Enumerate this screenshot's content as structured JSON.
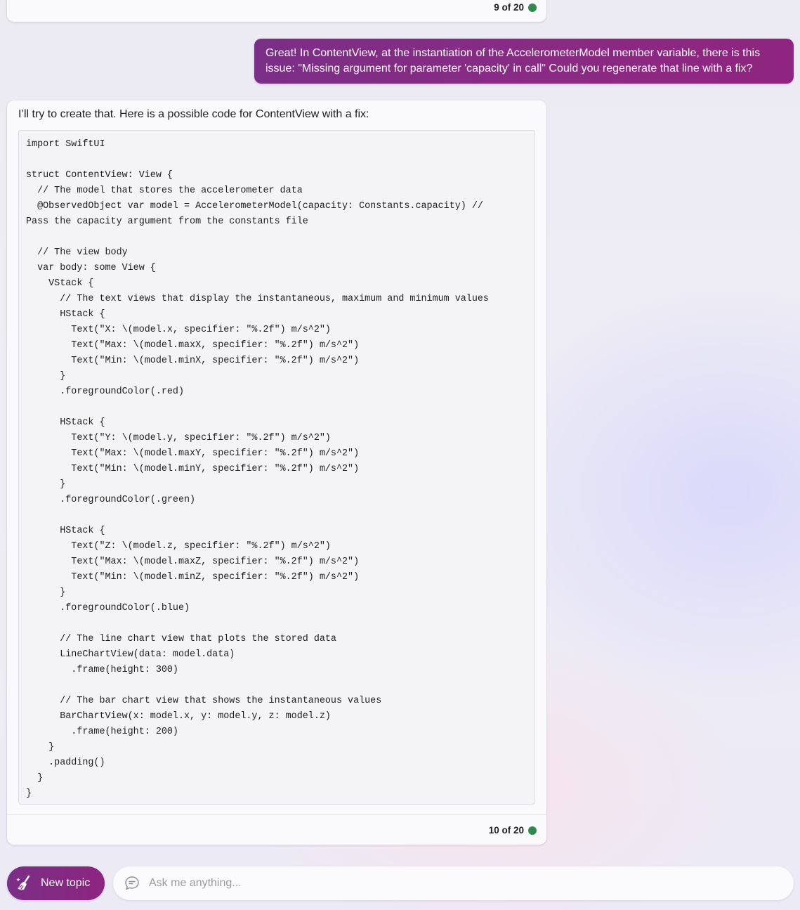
{
  "previous_message": {
    "counter": "9 of 20",
    "status_color": "#2f8a4c"
  },
  "user_message": {
    "text": "Great! In ContentView, at the instantiation of the AccelerometerModel member variable, there is this issue: \"Missing argument for parameter 'capacity' in call\" Could you regenerate that line with a fix?"
  },
  "bot_message": {
    "intro": "I’ll try to create that. Here is a possible code for ContentView with a fix:",
    "code": "import SwiftUI\n\nstruct ContentView: View {\n  // The model that stores the accelerometer data\n  @ObservedObject var model = AccelerometerModel(capacity: Constants.capacity) //\nPass the capacity argument from the constants file\n\n  // The view body\n  var body: some View {\n    VStack {\n      // The text views that display the instantaneous, maximum and minimum values\n      HStack {\n        Text(\"X: \\(model.x, specifier: \"%.2f\") m/s^2\")\n        Text(\"Max: \\(model.maxX, specifier: \"%.2f\") m/s^2\")\n        Text(\"Min: \\(model.minX, specifier: \"%.2f\") m/s^2\")\n      }\n      .foregroundColor(.red)\n\n      HStack {\n        Text(\"Y: \\(model.y, specifier: \"%.2f\") m/s^2\")\n        Text(\"Max: \\(model.maxY, specifier: \"%.2f\") m/s^2\")\n        Text(\"Min: \\(model.minY, specifier: \"%.2f\") m/s^2\")\n      }\n      .foregroundColor(.green)\n\n      HStack {\n        Text(\"Z: \\(model.z, specifier: \"%.2f\") m/s^2\")\n        Text(\"Max: \\(model.maxZ, specifier: \"%.2f\") m/s^2\")\n        Text(\"Min: \\(model.minZ, specifier: \"%.2f\") m/s^2\")\n      }\n      .foregroundColor(.blue)\n\n      // The line chart view that plots the stored data\n      LineChartView(data: model.data)\n        .frame(height: 300)\n\n      // The bar chart view that shows the instantaneous values\n      BarChartView(x: model.x, y: model.y, z: model.z)\n        .frame(height: 200)\n    }\n    .padding()\n  }\n}",
    "counter": "10 of 20",
    "status_color": "#2f8a4c"
  },
  "composer": {
    "new_topic_label": "New topic",
    "new_topic_icon": "broom-sparkle-icon",
    "chat_icon": "chat-bubble-icon",
    "input_placeholder": "Ask me anything...",
    "input_value": ""
  },
  "colors": {
    "accent_start": "#7b2f86",
    "accent_end": "#8f2580"
  }
}
